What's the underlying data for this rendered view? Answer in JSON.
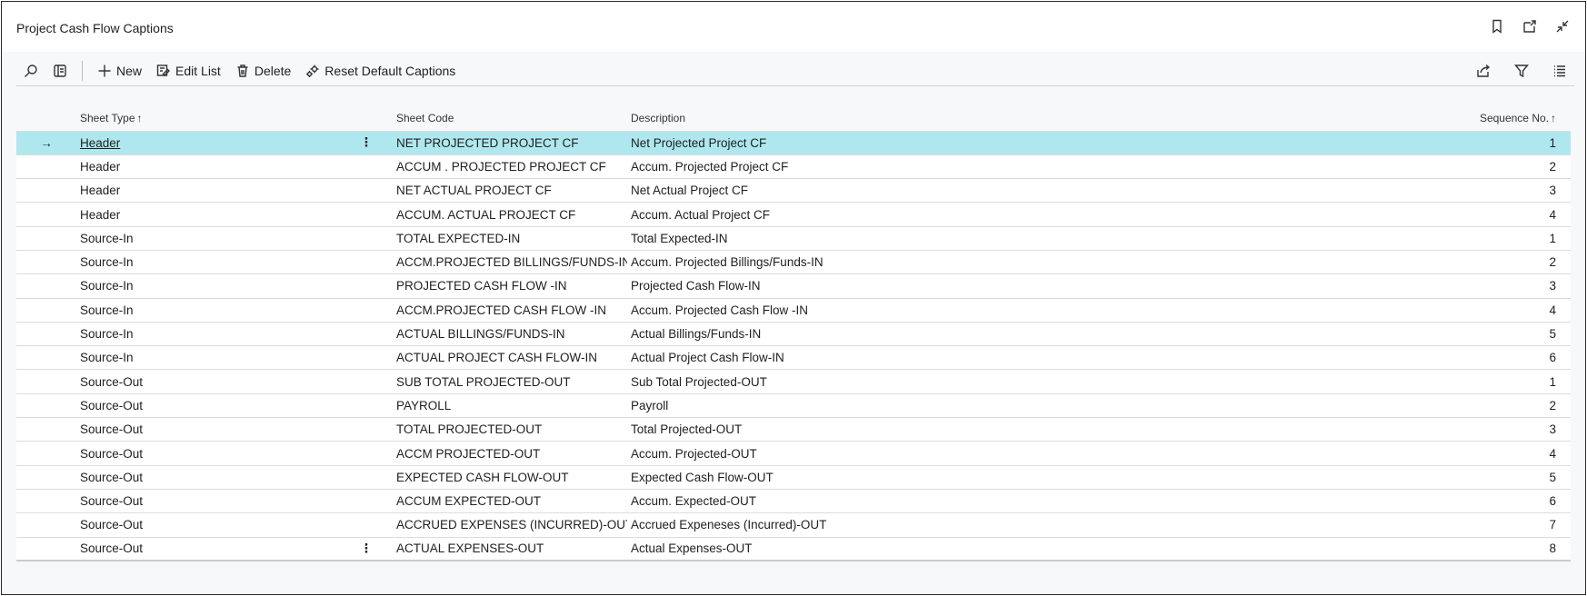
{
  "page": {
    "title": "Project Cash Flow Captions"
  },
  "toolbar": {
    "new_label": "New",
    "edit_list_label": "Edit List",
    "delete_label": "Delete",
    "reset_label": "Reset Default Captions"
  },
  "columns": {
    "sheet_type": "Sheet Type",
    "sheet_code": "Sheet Code",
    "description": "Description",
    "sequence_no": "Sequence No.",
    "sort_indicator": "↑"
  },
  "selection_arrow": "→",
  "row_menu": "⋮",
  "rows": [
    {
      "sheet_type": "Header",
      "sheet_code": "NET PROJECTED PROJECT CF",
      "description": "Net Projected Project CF",
      "sequence_no": "1"
    },
    {
      "sheet_type": "Header",
      "sheet_code": "ACCUM . PROJECTED PROJECT CF",
      "description": "Accum. Projected Project CF",
      "sequence_no": "2"
    },
    {
      "sheet_type": "Header",
      "sheet_code": "NET ACTUAL PROJECT CF",
      "description": "Net Actual Project CF",
      "sequence_no": "3"
    },
    {
      "sheet_type": "Header",
      "sheet_code": "ACCUM.  ACTUAL PROJECT CF",
      "description": "Accum. Actual Project CF",
      "sequence_no": "4"
    },
    {
      "sheet_type": "Source-In",
      "sheet_code": "TOTAL EXPECTED-IN",
      "description": "Total Expected-IN",
      "sequence_no": "1"
    },
    {
      "sheet_type": "Source-In",
      "sheet_code": "ACCM.PROJECTED BILLINGS/FUNDS-IN",
      "description": "Accum. Projected Billings/Funds-IN",
      "sequence_no": "2"
    },
    {
      "sheet_type": "Source-In",
      "sheet_code": "PROJECTED CASH FLOW -IN",
      "description": "Projected Cash Flow-IN",
      "sequence_no": "3"
    },
    {
      "sheet_type": "Source-In",
      "sheet_code": "ACCM.PROJECTED CASH FLOW -IN",
      "description": "Accum. Projected Cash Flow -IN",
      "sequence_no": "4"
    },
    {
      "sheet_type": "Source-In",
      "sheet_code": "ACTUAL BILLINGS/FUNDS-IN",
      "description": "Actual Billings/Funds-IN",
      "sequence_no": "5"
    },
    {
      "sheet_type": "Source-In",
      "sheet_code": "ACTUAL PROJECT CASH FLOW-IN",
      "description": "Actual Project Cash Flow-IN",
      "sequence_no": "6"
    },
    {
      "sheet_type": "Source-Out",
      "sheet_code": "SUB TOTAL PROJECTED-OUT",
      "description": "Sub Total Projected-OUT",
      "sequence_no": "1"
    },
    {
      "sheet_type": "Source-Out",
      "sheet_code": "PAYROLL",
      "description": "Payroll",
      "sequence_no": "2"
    },
    {
      "sheet_type": "Source-Out",
      "sheet_code": "TOTAL PROJECTED-OUT",
      "description": "Total Projected-OUT",
      "sequence_no": "3"
    },
    {
      "sheet_type": "Source-Out",
      "sheet_code": "ACCM PROJECTED-OUT",
      "description": "Accum. Projected-OUT",
      "sequence_no": "4"
    },
    {
      "sheet_type": "Source-Out",
      "sheet_code": "EXPECTED CASH FLOW-OUT",
      "description": "Expected Cash Flow-OUT",
      "sequence_no": "5"
    },
    {
      "sheet_type": "Source-Out",
      "sheet_code": "ACCUM EXPECTED-OUT",
      "description": "Accum. Expected-OUT",
      "sequence_no": "6"
    },
    {
      "sheet_type": "Source-Out",
      "sheet_code": "ACCRUED EXPENSES (INCURRED)-OUT",
      "description": "Accrued Expeneses (Incurred)-OUT",
      "sequence_no": "7"
    },
    {
      "sheet_type": "Source-Out",
      "sheet_code": "ACTUAL EXPENSES-OUT",
      "description": "Actual Expenses-OUT",
      "sequence_no": "8"
    }
  ]
}
